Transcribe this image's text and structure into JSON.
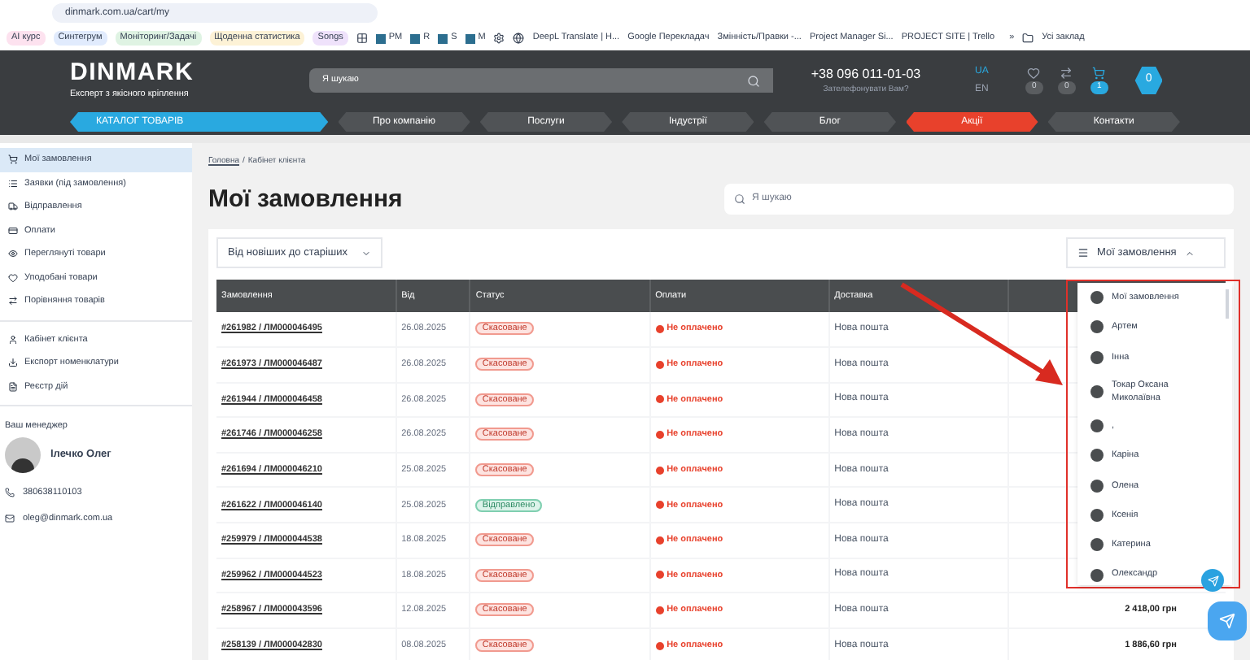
{
  "browser": {
    "url": "dinmark.com.ua/cart/my",
    "bookmarks": [
      {
        "label": "AI курс",
        "color": "#fde2ef"
      },
      {
        "label": "Синтегрум",
        "color": "#e1ebfd"
      },
      {
        "label": "Моніторинг/Задачі",
        "color": "#dff3e3"
      },
      {
        "label": "Щоденна статистика",
        "color": "#fdf2d6"
      },
      {
        "label": "Songs",
        "color": "#efe2fb"
      }
    ],
    "app_links": [
      "PM",
      "R",
      "S",
      "M"
    ],
    "links": [
      "DeepL Translate | H...",
      "Google Перекладач",
      "Змінність/Правки -...",
      "Project Manager Si...",
      "PROJECT SITE | Trello"
    ],
    "more": "»",
    "all_bookmarks": "Усі заклад"
  },
  "header": {
    "logo": "DINMARK",
    "tagline": "Експерт з якісного кріплення",
    "search_placeholder": "Я шукаю",
    "phone": "+38 096 011-01-03",
    "callback": "Зателефонувати Вам?",
    "languages": [
      {
        "label": "UA",
        "selected": true
      },
      {
        "label": "EN",
        "selected": false
      }
    ],
    "counters": [
      {
        "kind": "heart",
        "count": "0"
      },
      {
        "kind": "compare",
        "count": "0"
      },
      {
        "kind": "cart",
        "count": "1"
      }
    ],
    "user_badge": "0"
  },
  "nav": {
    "catalog": "КАТАЛОГ ТОВАРІВ",
    "items": [
      {
        "label": "Про компанію",
        "kind": "plain"
      },
      {
        "label": "Послуги",
        "kind": "plain"
      },
      {
        "label": "Індустрії",
        "kind": "plain"
      },
      {
        "label": "Блог",
        "kind": "plain"
      },
      {
        "label": "Акції",
        "kind": "promo"
      },
      {
        "label": "Контакти",
        "kind": "plain"
      }
    ]
  },
  "sidebar": {
    "groups": [
      [
        {
          "label": "Мої замовлення",
          "selected": true
        },
        {
          "label": "Заявки (під замовлення)",
          "selected": false
        },
        {
          "label": "Відправлення",
          "selected": false
        },
        {
          "label": "Оплати",
          "selected": false
        },
        {
          "label": "Переглянуті товари",
          "selected": false
        },
        {
          "label": "Уподобані товари",
          "selected": false
        },
        {
          "label": "Порівняння товарів",
          "selected": false
        }
      ],
      [
        {
          "label": "Кабінет клієнта",
          "selected": false
        },
        {
          "label": "Експорт номенклатури",
          "selected": false
        },
        {
          "label": "Реєстр дій",
          "selected": false
        }
      ]
    ],
    "manager_title": "Ваш менеджер",
    "manager_name": "Ілечко Олег",
    "phone": "380638110103",
    "email": "oleg@dinmark.com.ua"
  },
  "breadcrumb_separator": "/",
  "breadcrumb": [
    {
      "label": "Головна",
      "kind": "link"
    },
    {
      "label": "Кабінет клієнта",
      "kind": "current"
    }
  ],
  "page_title": "Мої замовлення",
  "search_placeholder": "Я шукаю",
  "sort": "Від новіших до старіших",
  "filter": {
    "label": "Мої замовлення",
    "expanded": true,
    "options": [
      "Мої замовлення",
      "Артем",
      "Інна",
      "Токар Оксана Миколаївна",
      ",",
      "Каріна",
      "Олена",
      "Ксенія",
      "Катерина",
      "Олександр"
    ]
  },
  "table": {
    "columns": [
      "Замовлення",
      "Від",
      "Статус",
      "Оплати",
      "Доставка"
    ],
    "rows": [
      {
        "order": "#261982 / ЛМ000046495",
        "date": "26.08.2025",
        "status": {
          "label": "Скасоване",
          "kind": "cancelled"
        },
        "payment": "Не оплачено",
        "delivery": "Нова пошта"
      },
      {
        "order": "#261973 / ЛМ000046487",
        "date": "26.08.2025",
        "status": {
          "label": "Скасоване",
          "kind": "cancelled"
        },
        "payment": "Не оплачено",
        "delivery": "Нова пошта"
      },
      {
        "order": "#261944 / ЛМ000046458",
        "date": "26.08.2025",
        "status": {
          "label": "Скасоване",
          "kind": "cancelled"
        },
        "payment": "Не оплачено",
        "delivery": "Нова пошта"
      },
      {
        "order": "#261746 / ЛМ000046258",
        "date": "26.08.2025",
        "status": {
          "label": "Скасоване",
          "kind": "cancelled"
        },
        "payment": "Не оплачено",
        "delivery": "Нова пошта"
      },
      {
        "order": "#261694 / ЛМ000046210",
        "date": "25.08.2025",
        "status": {
          "label": "Скасоване",
          "kind": "cancelled"
        },
        "payment": "Не оплачено",
        "delivery": "Нова пошта"
      },
      {
        "order": "#261622 / ЛМ000046140",
        "date": "25.08.2025",
        "status": {
          "label": "Відправлено",
          "kind": "sent"
        },
        "payment": "Не оплачено",
        "delivery": "Нова пошта"
      },
      {
        "order": "#259979 / ЛМ000044538",
        "date": "18.08.2025",
        "status": {
          "label": "Скасоване",
          "kind": "cancelled"
        },
        "payment": "Не оплачено",
        "delivery": "Нова пошта"
      },
      {
        "order": "#259962 / ЛМ000044523",
        "date": "18.08.2025",
        "status": {
          "label": "Скасоване",
          "kind": "cancelled"
        },
        "payment": "Не оплачено",
        "delivery": "Нова пошта"
      },
      {
        "order": "#258967 / ЛМ000043596",
        "date": "12.08.2025",
        "status": {
          "label": "Скасоване",
          "kind": "cancelled"
        },
        "payment": "Не оплачено",
        "delivery": "Нова пошта",
        "amount": "2 418,00 грн"
      },
      {
        "order": "#258139 / ЛМ000042830",
        "date": "08.08.2025",
        "status": {
          "label": "Скасоване",
          "kind": "cancelled"
        },
        "payment": "Не оплачено",
        "delivery": "Нова пошта",
        "amount": "1 886,60 грн"
      }
    ]
  }
}
